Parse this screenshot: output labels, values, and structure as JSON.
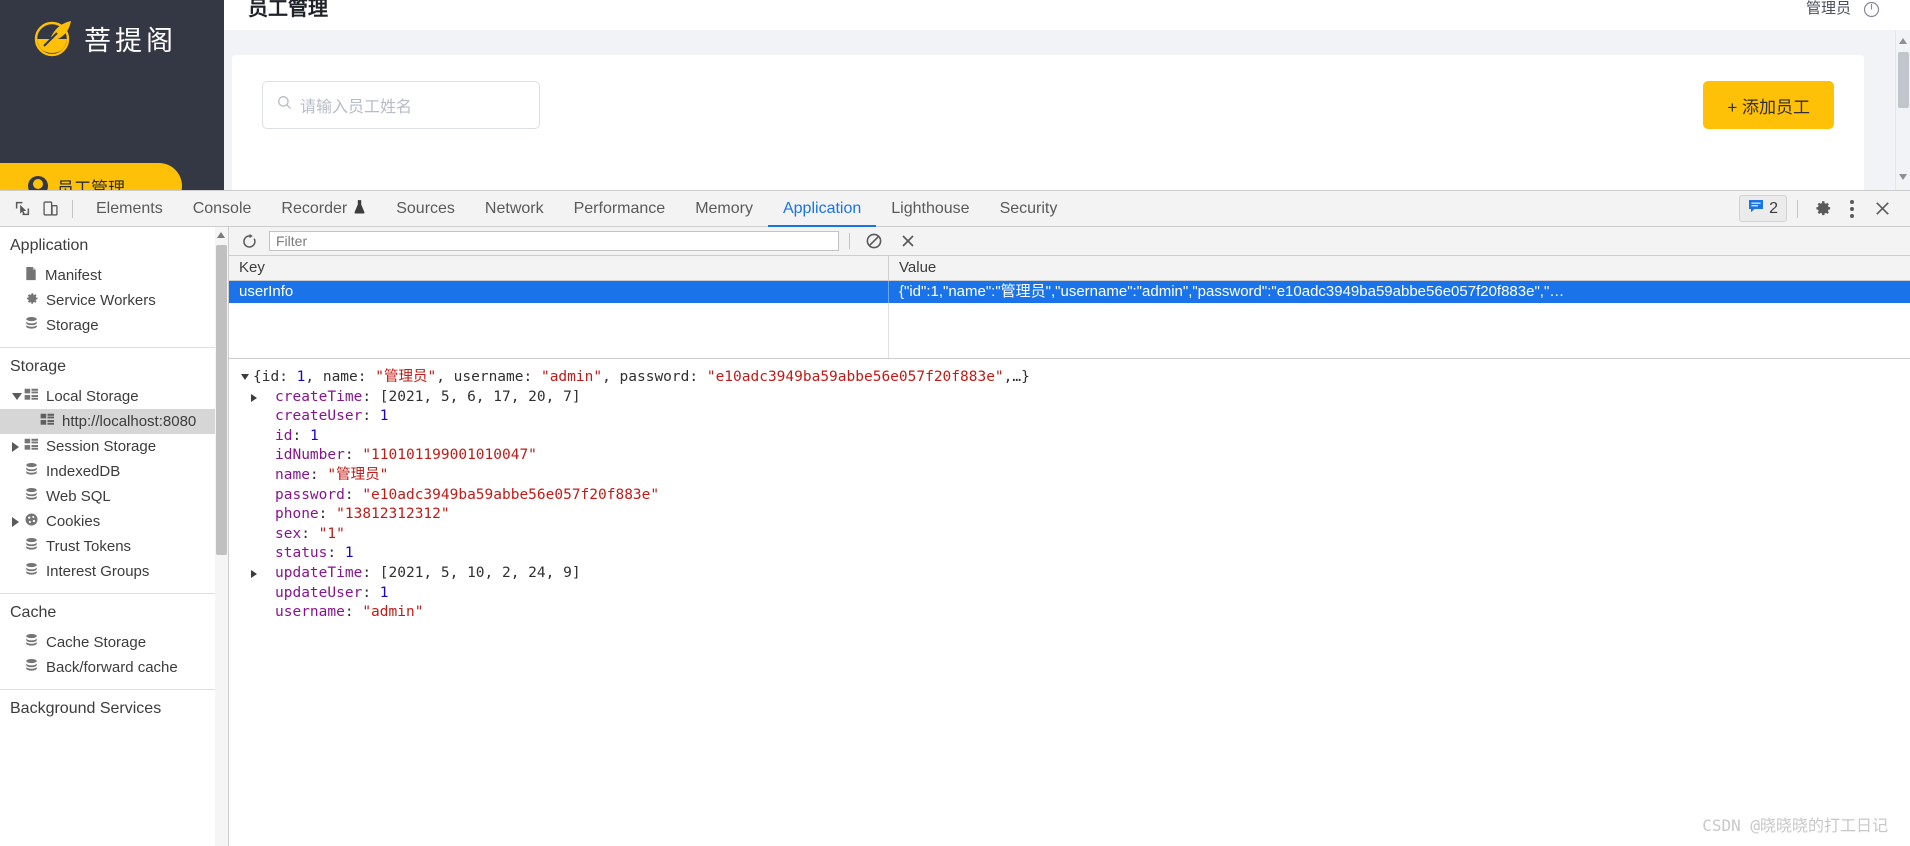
{
  "app": {
    "brand": "菩提阁",
    "brand_icon": "leaf-bowl-logo",
    "sidebar_active": {
      "label": "员工管理",
      "icon": "user-circle-icon"
    },
    "page_title": "员工管理",
    "header_user": "管理员",
    "power_icon": "power-icon",
    "search": {
      "placeholder": "请输入员工姓名",
      "value": "",
      "icon": "search-icon"
    },
    "add_button": "+ 添加员工"
  },
  "devtools": {
    "inspect_icon": "inspect-cursor-icon",
    "device_icon": "device-toolbar-icon",
    "tabs": [
      {
        "label": "Elements",
        "active": false
      },
      {
        "label": "Console",
        "active": false
      },
      {
        "label": "Recorder",
        "active": false,
        "badge": "flask-icon"
      },
      {
        "label": "Sources",
        "active": false
      },
      {
        "label": "Network",
        "active": false
      },
      {
        "label": "Performance",
        "active": false
      },
      {
        "label": "Memory",
        "active": false
      },
      {
        "label": "Application",
        "active": true
      },
      {
        "label": "Lighthouse",
        "active": false
      },
      {
        "label": "Security",
        "active": false
      }
    ],
    "message_count": "2",
    "message_icon": "message-bubble-icon",
    "settings_icon": "gear-icon",
    "more_icon": "kebab-menu-icon",
    "close_icon": "close-icon"
  },
  "application_panel": {
    "groups": [
      {
        "title": "Application",
        "items": [
          {
            "label": "Manifest",
            "icon": "document-icon",
            "twisty": "none",
            "indent": 0,
            "selected": false
          },
          {
            "label": "Service Workers",
            "icon": "gear-icon",
            "twisty": "none",
            "indent": 0,
            "selected": false
          },
          {
            "label": "Storage",
            "icon": "database-icon",
            "twisty": "none",
            "indent": 0,
            "selected": false
          }
        ]
      },
      {
        "title": "Storage",
        "items": [
          {
            "label": "Local Storage",
            "icon": "storage-grid-icon",
            "twisty": "open",
            "indent": 0,
            "selected": false
          },
          {
            "label": "http://localhost:8080",
            "icon": "storage-grid-icon",
            "twisty": "none",
            "indent": 1,
            "selected": true
          },
          {
            "label": "Session Storage",
            "icon": "storage-grid-icon",
            "twisty": "closed",
            "indent": 0,
            "selected": false
          },
          {
            "label": "IndexedDB",
            "icon": "database-icon",
            "twisty": "none",
            "indent": 0,
            "selected": false
          },
          {
            "label": "Web SQL",
            "icon": "database-icon",
            "twisty": "none",
            "indent": 0,
            "selected": false
          },
          {
            "label": "Cookies",
            "icon": "cookie-icon",
            "twisty": "closed",
            "indent": 0,
            "selected": false
          },
          {
            "label": "Trust Tokens",
            "icon": "database-icon",
            "twisty": "none",
            "indent": 0,
            "selected": false
          },
          {
            "label": "Interest Groups",
            "icon": "database-icon",
            "twisty": "none",
            "indent": 0,
            "selected": false
          }
        ]
      },
      {
        "title": "Cache",
        "items": [
          {
            "label": "Cache Storage",
            "icon": "database-icon",
            "twisty": "none",
            "indent": 0,
            "selected": false
          },
          {
            "label": "Back/forward cache",
            "icon": "database-icon",
            "twisty": "none",
            "indent": 0,
            "selected": false
          }
        ]
      },
      {
        "title": "Background Services",
        "items": []
      }
    ]
  },
  "storage_view": {
    "refresh_icon": "refresh-icon",
    "filter_placeholder": "Filter",
    "filter_value": "",
    "clear_all_icon": "clear-all-icon",
    "delete_selected_icon": "delete-selected-icon",
    "columns": [
      "Key",
      "Value"
    ],
    "rows": [
      {
        "key": "userInfo",
        "value": "{\"id\":1,\"name\":\"管理员\",\"username\":\"admin\",\"password\":\"e10adc3949ba59abbe56e057f20f883e\",\"…",
        "selected": true
      }
    ]
  },
  "preview": {
    "summary": {
      "prefix": "{id: ",
      "id": "1",
      "sep1": ", name: ",
      "name": "\"管理员\"",
      "sep2": ", username: ",
      "username": "\"admin\"",
      "sep3": ", password: ",
      "password": "\"e10adc3949ba59abbe56e057f20f883e\"",
      "suffix": ",…}"
    },
    "entries": [
      {
        "key": "createTime",
        "value": "[2021, 5, 6, 17, 20, 7]",
        "kind": "array",
        "twisty": "closed"
      },
      {
        "key": "createUser",
        "value": "1",
        "kind": "number",
        "twisty": "none"
      },
      {
        "key": "id",
        "value": "1",
        "kind": "number",
        "twisty": "none"
      },
      {
        "key": "idNumber",
        "value": "\"110101199001010047\"",
        "kind": "string",
        "twisty": "none"
      },
      {
        "key": "name",
        "value": "\"管理员\"",
        "kind": "string",
        "twisty": "none"
      },
      {
        "key": "password",
        "value": "\"e10adc3949ba59abbe56e057f20f883e\"",
        "kind": "string",
        "twisty": "none"
      },
      {
        "key": "phone",
        "value": "\"13812312312\"",
        "kind": "string",
        "twisty": "none"
      },
      {
        "key": "sex",
        "value": "\"1\"",
        "kind": "string",
        "twisty": "none"
      },
      {
        "key": "status",
        "value": "1",
        "kind": "number",
        "twisty": "none"
      },
      {
        "key": "updateTime",
        "value": "[2021, 5, 10, 2, 24, 9]",
        "kind": "array",
        "twisty": "closed"
      },
      {
        "key": "updateUser",
        "value": "1",
        "kind": "number",
        "twisty": "none"
      },
      {
        "key": "username",
        "value": "\"admin\"",
        "kind": "string",
        "twisty": "none"
      }
    ]
  },
  "watermark": "CSDN @晓晓晓的打工日记"
}
